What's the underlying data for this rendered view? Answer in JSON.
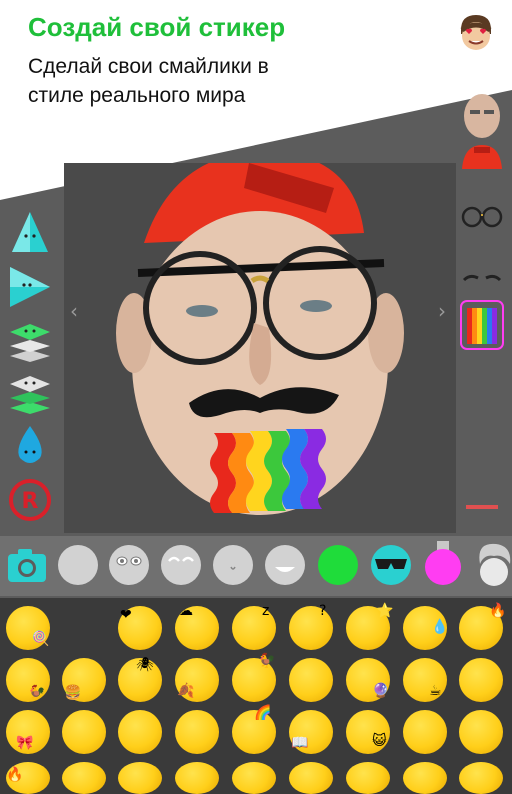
{
  "header": {
    "title": "Создай свой стикер",
    "subtitle_line1": "Сделай свои смайлики в",
    "subtitle_line2": "стиле реального мира"
  },
  "colors": {
    "title_green": "#1fbf3a",
    "teal": "#2ad0d0",
    "green_tool": "#3ddc6b",
    "red_r": "#d9202a",
    "magenta": "#ff3df2",
    "canvas_bg": "#4a4a4a",
    "panel_bg": "#5c5c5c",
    "grid_bg": "#3a3a3a"
  },
  "canvas": {
    "left_arrow": "‹",
    "right_arrow": "›",
    "layers": [
      "red-cap",
      "glasses",
      "mustache",
      "rainbow-tongue",
      "photo-face"
    ]
  },
  "left_tools": [
    {
      "icon": "triangle-shape-icon"
    },
    {
      "icon": "flag-shape-icon"
    },
    {
      "icon": "layers-green-icon"
    },
    {
      "icon": "layers-gray-icon"
    },
    {
      "icon": "water-drop-icon"
    },
    {
      "icon": "registered-mark-icon"
    }
  ],
  "right_strip": [
    {
      "icon": "face-photo-thumb"
    },
    {
      "icon": "red-cap-thumb"
    },
    {
      "icon": "glasses-thumb"
    },
    {
      "icon": "eyebrows-thumb"
    },
    {
      "icon": "rainbow-thumb",
      "selected": true
    },
    {
      "icon": "red-dash-thumb"
    }
  ],
  "bottom_bar": [
    {
      "icon": "camera-icon"
    },
    {
      "icon": "blank-face-icon"
    },
    {
      "icon": "eyes-face-icon"
    },
    {
      "icon": "closed-eyes-face-icon"
    },
    {
      "icon": "nose-face-icon"
    },
    {
      "icon": "smile-face-icon"
    },
    {
      "icon": "green-face-icon"
    },
    {
      "icon": "sunglasses-face-icon"
    },
    {
      "icon": "magenta-potion-icon"
    },
    {
      "icon": "hair-icon"
    }
  ],
  "grid_decor": [
    "🍭",
    "❤",
    "☁",
    "z",
    "?",
    "⭐",
    "💧",
    "🔥",
    "🐓",
    "🍔",
    "🕷",
    "🍂",
    "🐓",
    "👻",
    "🔮",
    "☕",
    "🎀",
    "🌈",
    "👽",
    "📖",
    "😺",
    "🍊",
    "🔥"
  ]
}
